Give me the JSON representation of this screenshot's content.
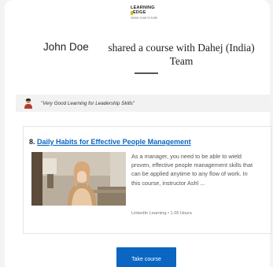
{
  "brand": {
    "logo_line1": "LEARNING",
    "logo_line2": "EDGE",
    "logo_tagline": "GROW YOUR FUTURE",
    "accent": "#e6b800"
  },
  "header": {
    "sender_name": "John Doe",
    "headline": "shared a course with Dahej (India) Team"
  },
  "recommendation": {
    "quote": "\"Very Good Learning for Leadership Skills\"",
    "avatar_icon": "person-avatar-icon"
  },
  "course": {
    "number": "8.",
    "title": "Daily Habits for Effective People Management",
    "description": "As a manager, you need to be able to wield proven, effective people management skills that can be applied anytime to any flow of work. In this course, instructor Ashl ...",
    "meta": "LinkedIn Learning • 1.05 Hours",
    "link_color": "#0a66c2"
  },
  "actions": {
    "take_course_label": "Take course",
    "button_color": "#0a66c2"
  }
}
